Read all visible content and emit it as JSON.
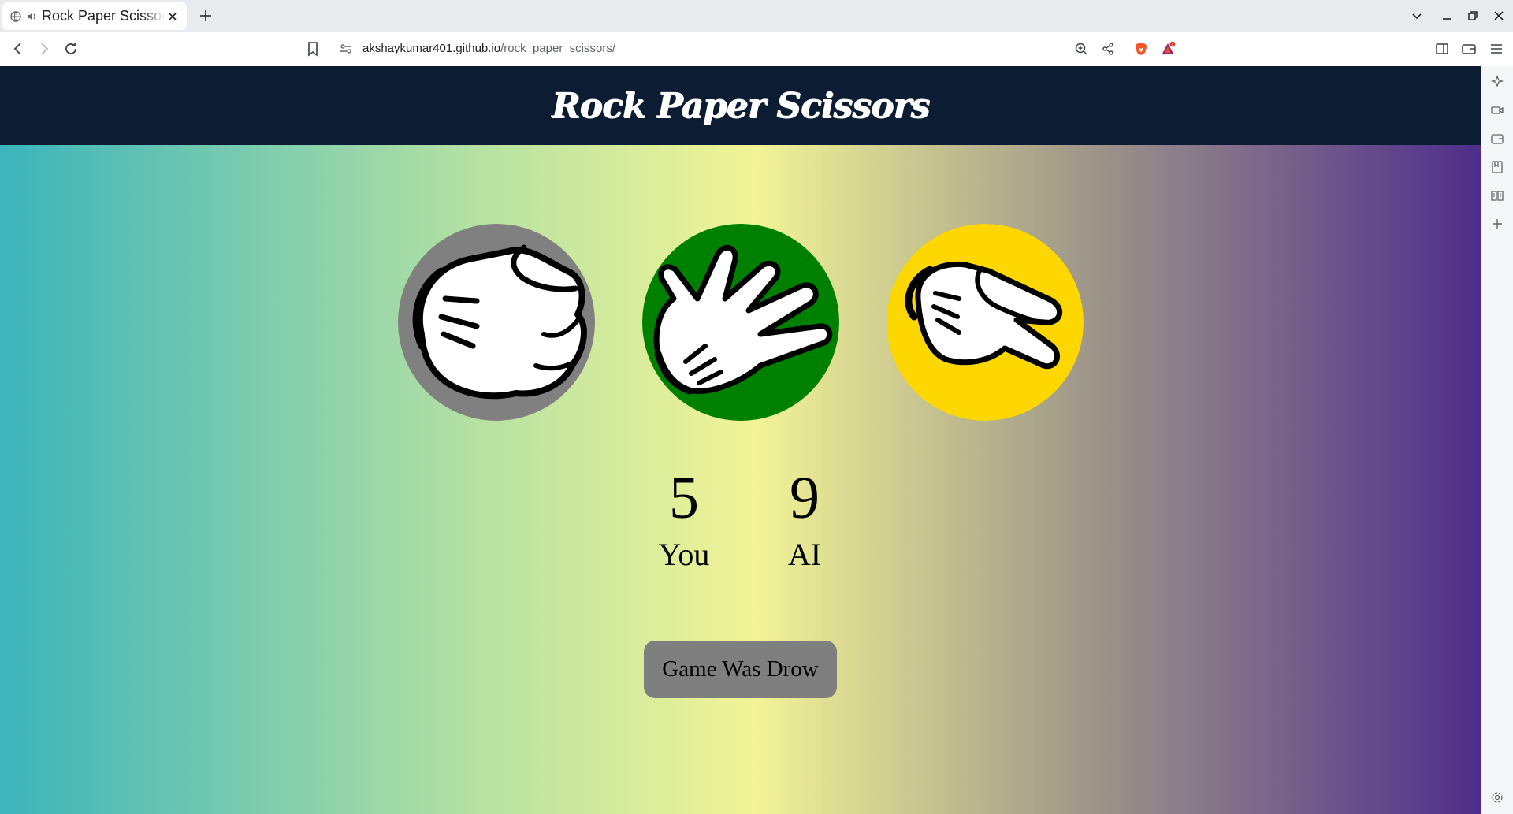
{
  "browser": {
    "tab_title": "Rock Paper Scissors",
    "url_host": "akshaykumar401.github.io",
    "url_path": "/rock_paper_scissors/"
  },
  "page": {
    "title": "Rock Paper Scissors"
  },
  "choices": [
    {
      "name": "rock",
      "color": "#808080"
    },
    {
      "name": "paper",
      "color": "#008000"
    },
    {
      "name": "scissors",
      "color": "#ffd700"
    }
  ],
  "scoreboard": {
    "player_score": "5",
    "player_label": "You",
    "ai_score": "9",
    "ai_label": "AI"
  },
  "result": {
    "message": "Game Was Drow"
  },
  "colors": {
    "header_bg": "#0b1c33",
    "gradient": [
      "#3bb4bb",
      "#b8e2a2",
      "#f2f496",
      "#a39c8a",
      "#4e2d8b"
    ],
    "result_bg": "#7f7f7f"
  }
}
